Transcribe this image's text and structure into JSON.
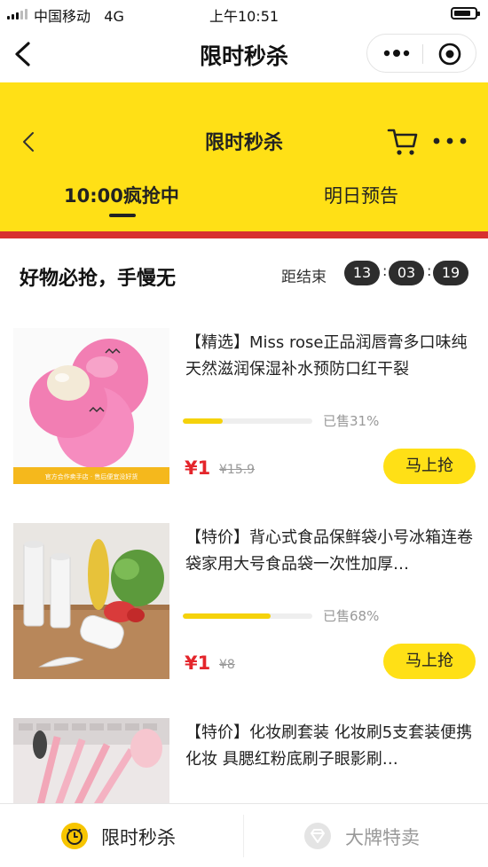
{
  "status_bar": {
    "carrier": "中国移动",
    "network": "4G",
    "time": "上午10:51"
  },
  "nav": {
    "title": "限时秒杀"
  },
  "header": {
    "title": "限时秒杀",
    "tabs": [
      {
        "label": "10:00疯抢中",
        "active": true
      },
      {
        "label": "明日预告",
        "active": false
      }
    ],
    "accent_color": "#ffe016",
    "divider_color": "#d8312f"
  },
  "section": {
    "title": "好物必抢，手慢无",
    "countdown_label": "距结束",
    "countdown": [
      "13",
      "03",
      "19"
    ]
  },
  "products": [
    {
      "title": "【精选】Miss rose正品润唇膏多口味纯天然滋润保湿补水预防口红干裂",
      "sold_percent": 31,
      "sold_text": "已售31%",
      "price": "¥1",
      "original_price": "¥15.9",
      "button_label": "马上抢",
      "image_caption": "官方合作卖手店 · 售后便宜没好货"
    },
    {
      "title": "【特价】背心式食品保鲜袋小号冰箱连卷袋家用大号食品袋一次性加厚…",
      "sold_percent": 68,
      "sold_text": "已售68%",
      "price": "¥1",
      "original_price": "¥8",
      "button_label": "马上抢"
    },
    {
      "title": "【特价】化妆刷套装 化妆刷5支套装便携化妆 具腮红粉底刷子眼影刷…"
    }
  ],
  "tabbar": {
    "items": [
      {
        "label": "限时秒杀",
        "active": true,
        "icon": "clock-icon"
      },
      {
        "label": "大牌特卖",
        "active": false,
        "icon": "diamond-icon"
      }
    ],
    "active_color": "#222222",
    "inactive_color": "#999999"
  }
}
